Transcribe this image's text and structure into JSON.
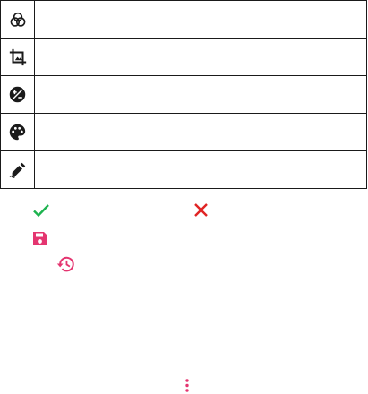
{
  "tools": [
    {
      "id": "filters",
      "icon": "color-filter-icon",
      "label": ""
    },
    {
      "id": "crop",
      "icon": "crop-icon",
      "label": ""
    },
    {
      "id": "exposure",
      "icon": "exposure-icon",
      "label": ""
    },
    {
      "id": "color",
      "icon": "palette-icon",
      "label": ""
    },
    {
      "id": "draw",
      "icon": "draw-pen-icon",
      "label": ""
    }
  ],
  "actions": {
    "apply_icon": "check-icon",
    "cancel_icon": "close-icon",
    "save_icon": "save-icon",
    "history_icon": "history-icon",
    "more_icon": "more-vert-icon"
  },
  "colors": {
    "text": "#1a1a1a",
    "apply": "#1db34f",
    "cancel": "#e02424",
    "accent": "#e43570"
  }
}
